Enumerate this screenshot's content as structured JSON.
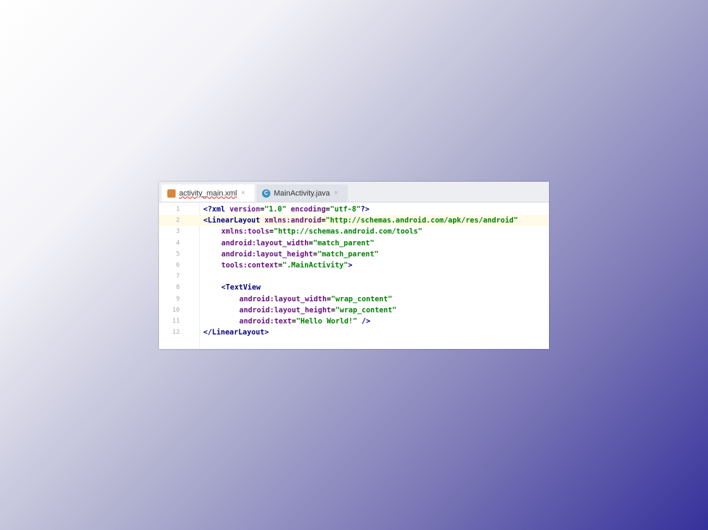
{
  "tabs": [
    {
      "label": "activity_main.xml",
      "close": "×",
      "icon": "xml-file-icon",
      "active": true
    },
    {
      "label": "MainActivity.java",
      "close": "×",
      "icon": "java-class-icon",
      "icon_letter": "C",
      "active": false
    }
  ],
  "colors": {
    "tag": "#000080",
    "attr": "#660e7a",
    "string": "#008000"
  },
  "lines": [
    {
      "n": "1",
      "indent": 0,
      "tokens": [
        {
          "c": "tag",
          "t": "<?xml "
        },
        {
          "c": "attr",
          "t": "version"
        },
        {
          "c": "plain",
          "t": "="
        },
        {
          "c": "str",
          "t": "\"1.0\" "
        },
        {
          "c": "attr",
          "t": "encoding"
        },
        {
          "c": "plain",
          "t": "="
        },
        {
          "c": "str",
          "t": "\"utf-8\""
        },
        {
          "c": "tag",
          "t": "?>"
        }
      ]
    },
    {
      "n": "2",
      "indent": 0,
      "cur": true,
      "tokens": [
        {
          "c": "tag",
          "t": "<LinearLayout "
        },
        {
          "c": "attr",
          "t": "xmlns:android"
        },
        {
          "c": "plain",
          "t": "="
        },
        {
          "c": "str",
          "t": "\"http://schemas.android.com/apk/res/android\""
        }
      ]
    },
    {
      "n": "3",
      "indent": 1,
      "tokens": [
        {
          "c": "attr",
          "t": "xmlns:tools"
        },
        {
          "c": "plain",
          "t": "="
        },
        {
          "c": "str",
          "t": "\"http://schemas.android.com/tools\""
        }
      ]
    },
    {
      "n": "4",
      "indent": 1,
      "tokens": [
        {
          "c": "attr",
          "t": "android:layout_width"
        },
        {
          "c": "plain",
          "t": "="
        },
        {
          "c": "str",
          "t": "\"match_parent\""
        }
      ]
    },
    {
      "n": "5",
      "indent": 1,
      "tokens": [
        {
          "c": "attr",
          "t": "android:layout_height"
        },
        {
          "c": "plain",
          "t": "="
        },
        {
          "c": "str",
          "t": "\"match_parent\""
        }
      ]
    },
    {
      "n": "6",
      "indent": 1,
      "tokens": [
        {
          "c": "attr",
          "t": "tools:context"
        },
        {
          "c": "plain",
          "t": "="
        },
        {
          "c": "str",
          "t": "\".MainActivity\""
        },
        {
          "c": "tag",
          "t": ">"
        }
      ]
    },
    {
      "n": "7",
      "indent": 0,
      "tokens": []
    },
    {
      "n": "8",
      "indent": 1,
      "tokens": [
        {
          "c": "tag",
          "t": "<TextView"
        }
      ]
    },
    {
      "n": "9",
      "indent": 2,
      "tokens": [
        {
          "c": "attr",
          "t": "android:layout_width"
        },
        {
          "c": "plain",
          "t": "="
        },
        {
          "c": "str",
          "t": "\"wrap_content\""
        }
      ]
    },
    {
      "n": "10",
      "indent": 2,
      "tokens": [
        {
          "c": "attr",
          "t": "android:layout_height"
        },
        {
          "c": "plain",
          "t": "="
        },
        {
          "c": "str",
          "t": "\"wrap_content\""
        }
      ]
    },
    {
      "n": "11",
      "indent": 2,
      "tokens": [
        {
          "c": "attr",
          "t": "android:text"
        },
        {
          "c": "plain",
          "t": "="
        },
        {
          "c": "str",
          "t": "\"Hello World!\""
        },
        {
          "c": "tag",
          "t": " />"
        }
      ]
    },
    {
      "n": "12",
      "indent": 0,
      "tokens": [
        {
          "c": "tag",
          "t": "</LinearLayout>"
        }
      ]
    }
  ]
}
